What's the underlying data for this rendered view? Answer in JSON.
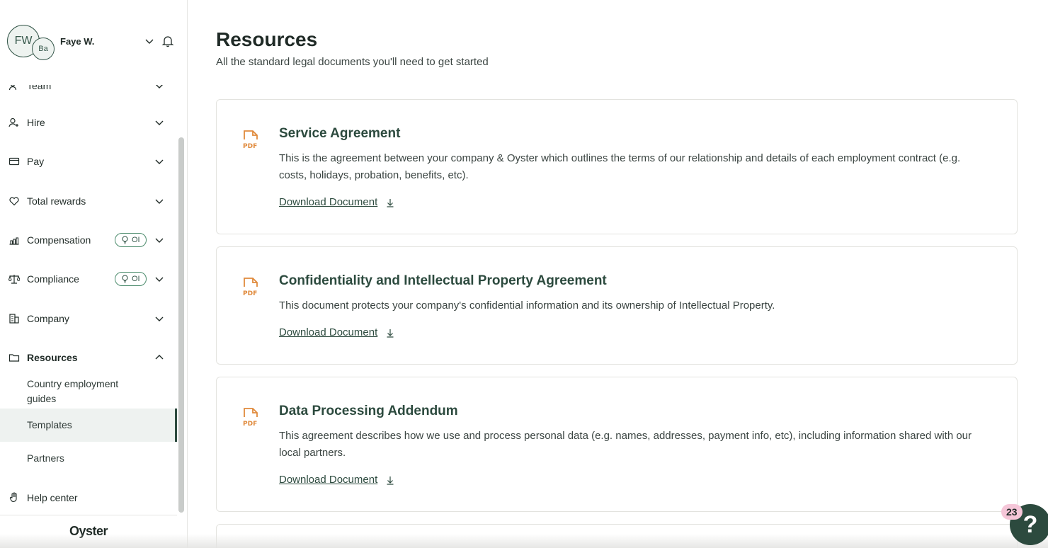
{
  "user": {
    "initials": "FW",
    "org_initials": "Ba",
    "name": "Faye W."
  },
  "nav": {
    "partial_item_label": "Team",
    "items": [
      {
        "label": "Hire",
        "icon": "user-plus-icon"
      },
      {
        "label": "Pay",
        "icon": "wallet-icon"
      },
      {
        "label": "Total rewards",
        "icon": "heart-icon"
      },
      {
        "label": "Compensation",
        "icon": "chart-icon",
        "badge": "OI"
      },
      {
        "label": "Compliance",
        "icon": "scale-icon",
        "badge": "OI"
      },
      {
        "label": "Company",
        "icon": "building-icon"
      },
      {
        "label": "Resources",
        "icon": "folder-icon"
      }
    ],
    "resources_sub": [
      {
        "label": "Country employment guides"
      },
      {
        "label": "Templates"
      },
      {
        "label": "Partners"
      }
    ],
    "help_center": "Help center"
  },
  "brand": "Oyster",
  "page": {
    "title": "Resources",
    "subtitle": "All the standard legal documents you'll need to get started"
  },
  "documents": [
    {
      "title": "Service Agreement",
      "description": "This is the agreement between your company & Oyster which outlines the terms of our relationship and details of each employment contract (e.g. costs, holidays, probation, benefits, etc).",
      "link": "Download Document"
    },
    {
      "title": "Confidentiality and Intellectual Property Agreement",
      "description": "This document protects your company's confidential information and its ownership of Intellectual Property.",
      "link": "Download Document"
    },
    {
      "title": "Data Processing Addendum",
      "description": "This agreement describes how we use and process personal data (e.g. names, addresses, payment info, etc), including information shared with our local partners.",
      "link": "Download Document"
    }
  ],
  "pdf_label": "PDF",
  "help_widget": {
    "count": "23",
    "symbol": "?"
  },
  "colors": {
    "accent": "#2c4a3e",
    "pdf": "#e08a3c",
    "badge_border": "#4b8b6c",
    "help_count_bg": "#f5c6d8"
  }
}
